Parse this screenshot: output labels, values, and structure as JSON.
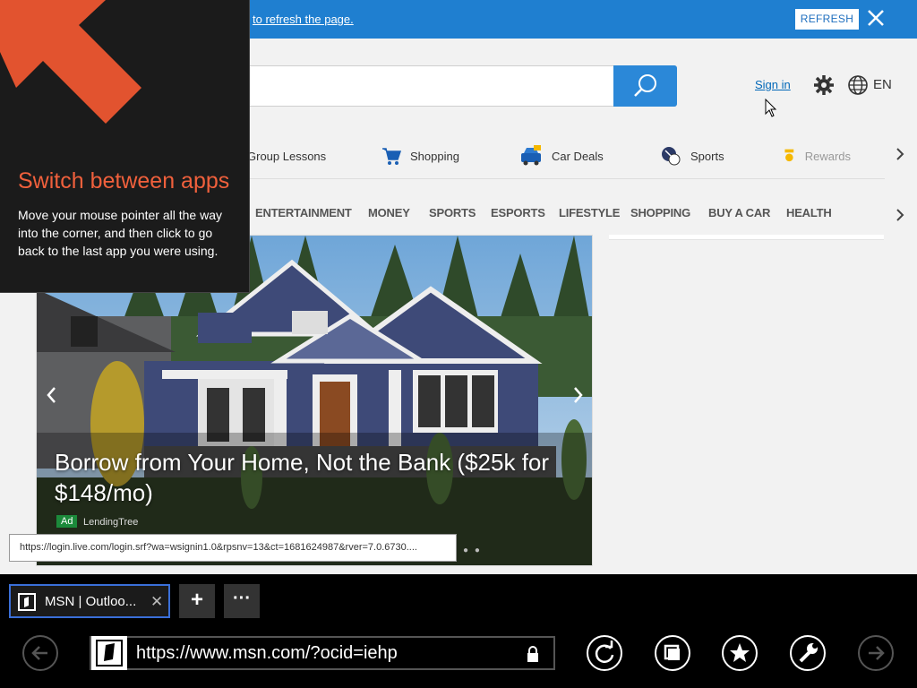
{
  "notification": {
    "message": "to refresh the page.",
    "refresh_label": "REFRESH"
  },
  "header": {
    "sign_in": "Sign in",
    "language": "EN"
  },
  "quick_links": [
    {
      "label": "Group Lessons"
    },
    {
      "label": "Shopping"
    },
    {
      "label": "Car Deals"
    },
    {
      "label": "Sports"
    },
    {
      "label": "Rewards"
    }
  ],
  "nav": [
    "ENTERTAINMENT",
    "MONEY",
    "SPORTS",
    "ESPORTS",
    "LIFESTYLE",
    "SHOPPING",
    "BUY A CAR",
    "HEALTH"
  ],
  "hero": {
    "title": "Borrow from Your Home, Not the Bank ($25k for $148/mo)",
    "ad_badge": "Ad",
    "source": "LendingTree"
  },
  "status_url": "https://login.live.com/login.srf?wa=wsignin1.0&rpsnv=13&ct=1681624987&rver=7.0.6730....",
  "tip": {
    "title": "Switch between apps",
    "body": "Move your mouse pointer all the way into the corner, and then click to go back to the last app you were using."
  },
  "browser": {
    "tab_label": "MSN | Outloo...",
    "address": "https://www.msn.com/?ocid=iehp"
  },
  "colors": {
    "accent_blue": "#1f7fd0",
    "tip_title": "#f0603c",
    "ad_green": "#1c8a3b"
  }
}
